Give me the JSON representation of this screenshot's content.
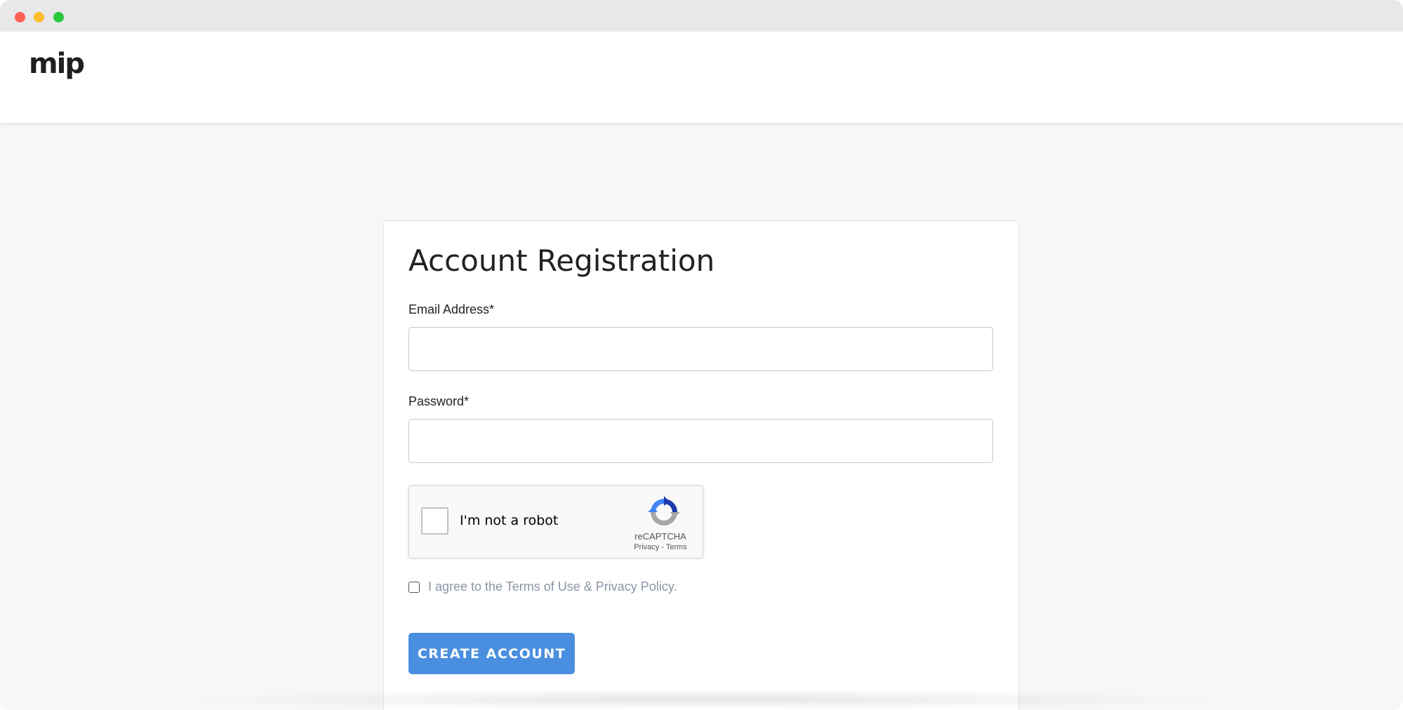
{
  "window": {
    "controls": [
      "close",
      "minimize",
      "zoom"
    ]
  },
  "header": {
    "logo_text": "mip"
  },
  "form": {
    "title": "Account Registration",
    "email": {
      "label": "Email Address*",
      "value": "",
      "placeholder": ""
    },
    "password": {
      "label": "Password*",
      "value": "",
      "placeholder": ""
    },
    "recaptcha": {
      "label": "I'm not a robot",
      "brand": "reCAPTCHA",
      "privacy_link": "Privacy",
      "separator": " - ",
      "terms_link": "Terms",
      "checked": false
    },
    "agree": {
      "prefix": "I agree to the ",
      "terms_link": "Terms of Use & Privacy Policy",
      "suffix": ".",
      "checked": false
    },
    "submit_label": "CREATE ACCOUNT"
  },
  "colors": {
    "accent": "#4a8fdf",
    "page_background": "#f7f7f7",
    "muted_text": "#8a95a5"
  },
  "icons": {
    "recaptcha": "recaptcha-icon"
  }
}
